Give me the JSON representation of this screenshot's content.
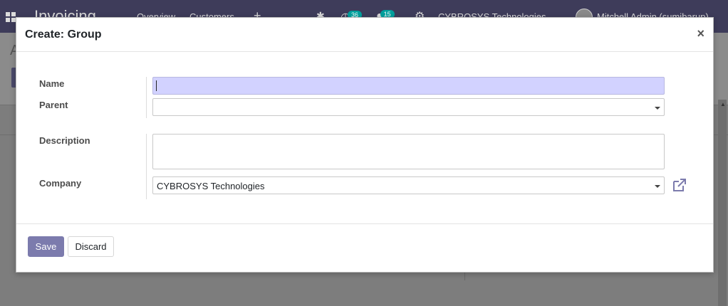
{
  "app": {
    "title": "Invoicing",
    "menu": [
      "Overview",
      "Customers"
    ],
    "plus_glyph": "+",
    "activity_count": "36",
    "message_count": "15",
    "company": "CYBROSYS Technologies",
    "user": "Mitchell Admin (sumibarup)"
  },
  "dialog": {
    "title": "Create: Group",
    "close_glyph": "×",
    "fields": {
      "name": {
        "label": "Name",
        "value": ""
      },
      "parent": {
        "label": "Parent",
        "value": ""
      },
      "description": {
        "label": "Description",
        "value": ""
      },
      "company": {
        "label": "Company",
        "value": "CYBROSYS Technologies"
      }
    },
    "buttons": {
      "save": "Save",
      "discard": "Discard"
    }
  },
  "icons": {
    "external_link": "external-link-icon",
    "close": "close-icon",
    "dropdown": "caret-down-icon"
  },
  "colors": {
    "primary": "#7c7bad",
    "navbar": "#3e3c5a",
    "focus_input": "#d2d2ff",
    "badge": "#00a09d"
  }
}
